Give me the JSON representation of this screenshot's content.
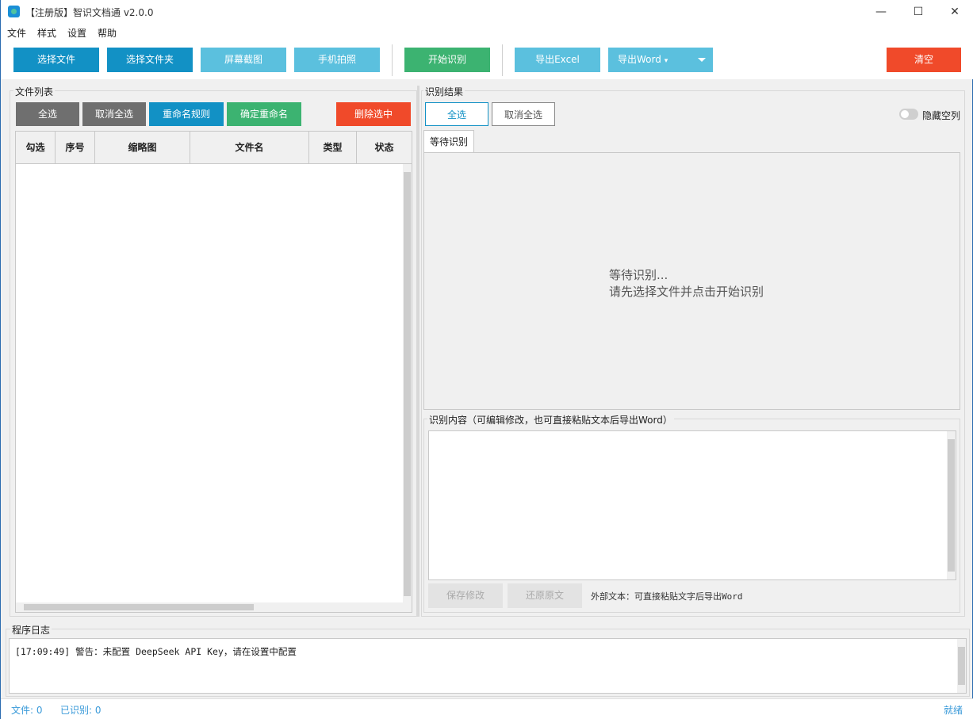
{
  "window": {
    "title": "【注册版】智识文档通 v2.0.0",
    "minimize": "—",
    "maximize": "☐",
    "close": "✕"
  },
  "menu": [
    "文件",
    "样式",
    "设置",
    "帮助"
  ],
  "toolbar": {
    "select_file": "选择文件",
    "select_folder": "选择文件夹",
    "screenshot": "屏幕截图",
    "phone_photo": "手机拍照",
    "start_recognition": "开始识别",
    "export_excel": "导出Excel",
    "export_word": "导出Word",
    "export_word_arrow": "▾",
    "clear": "清空"
  },
  "file_list": {
    "label": "文件列表",
    "select_all": "全选",
    "deselect_all": "取消全选",
    "rename_rules": "重命名规则",
    "confirm_rename": "确定重命名",
    "delete_selected": "删除选中",
    "columns": [
      "勾选",
      "序号",
      "缩略图",
      "文件名",
      "类型",
      "状态"
    ],
    "rows": []
  },
  "results": {
    "label": "识别结果",
    "select_all": "全选",
    "deselect_all": "取消全选",
    "hide_empty": "隐藏空列",
    "hide_empty_on": false,
    "tab": "等待识别",
    "waiting_line1": "等待识别...",
    "waiting_line2": "请先选择文件并点击开始识别"
  },
  "content": {
    "label": "识别内容（可编辑修改，也可直接粘贴文本后导出Word）",
    "value": "",
    "save": "保存修改",
    "restore": "还原原文",
    "hint": "外部文本：可直接粘贴文字后导出Word"
  },
  "log": {
    "label": "程序日志",
    "lines": [
      "[17:09:49] 警告：未配置 DeepSeek API Key，请在设置中配置"
    ]
  },
  "status": {
    "files": "文件: 0",
    "recognized": "已识别: 0",
    "state": "就绪"
  },
  "colors": {
    "primary": "#1291c5",
    "light_blue": "#5bc0de",
    "green": "#3cb371",
    "red": "#f04a2a",
    "gray": "#6f6f6f",
    "status_text": "#3a9ad9"
  }
}
